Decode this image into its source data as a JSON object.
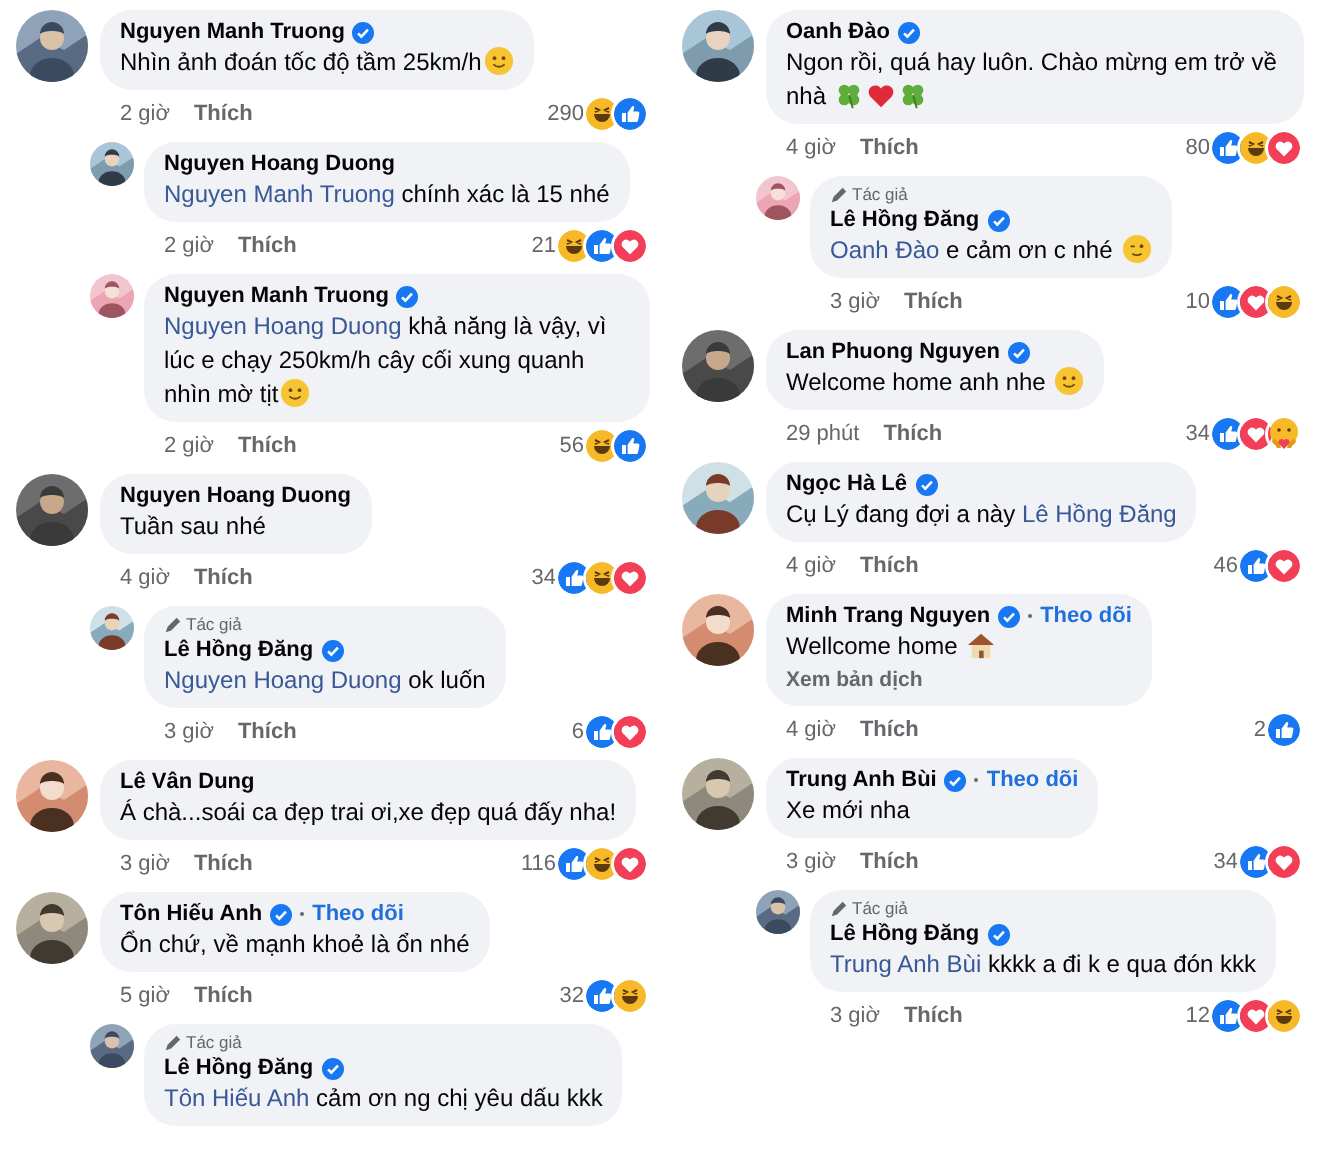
{
  "columns": [
    {
      "comments": [
        {
          "reply": false,
          "author": "Nguyen Manh Truong",
          "verified": true,
          "body": [
            {
              "kind": "plain",
              "text": "Nhìn ảnh đoán tốc độ tầm 25km/h"
            },
            {
              "kind": "smiley"
            }
          ],
          "time": "2 giờ",
          "like_label": "Thích",
          "count": "290",
          "reactions": [
            {
              "kind": "haha"
            },
            {
              "kind": "like"
            }
          ]
        },
        {
          "reply": true,
          "author": "Nguyen Hoang Duong",
          "verified": false,
          "body": [
            {
              "kind": "mention",
              "text": "Nguyen Manh Truong"
            },
            {
              "kind": "plain",
              "text": " chính xác là 15 nhé"
            }
          ],
          "time": "2 giờ",
          "like_label": "Thích",
          "count": "21",
          "reactions": [
            {
              "kind": "haha"
            },
            {
              "kind": "like"
            },
            {
              "kind": "love"
            }
          ]
        },
        {
          "reply": true,
          "author": "Nguyen Manh Truong",
          "verified": true,
          "body": [
            {
              "kind": "mention",
              "text": "Nguyen Hoang Duong"
            },
            {
              "kind": "plain",
              "text": " khả năng là vậy, vì lúc e chạy 250km/h cây cối xung quanh nhìn mờ tịt"
            },
            {
              "kind": "smiley"
            }
          ],
          "time": "2 giờ",
          "like_label": "Thích",
          "count": "56",
          "reactions": [
            {
              "kind": "haha"
            },
            {
              "kind": "like"
            }
          ]
        },
        {
          "reply": false,
          "author": "Nguyen Hoang Duong",
          "verified": false,
          "body": [
            {
              "kind": "plain",
              "text": "Tuần sau nhé"
            }
          ],
          "time": "4 giờ",
          "like_label": "Thích",
          "count": "34",
          "reactions": [
            {
              "kind": "like"
            },
            {
              "kind": "haha"
            },
            {
              "kind": "love"
            }
          ]
        },
        {
          "reply": true,
          "author_tag": "Tác giả",
          "author": "Lê Hồng Đăng",
          "verified": true,
          "body": [
            {
              "kind": "mention",
              "text": "Nguyen Hoang Duong"
            },
            {
              "kind": "plain",
              "text": " ok luốn"
            }
          ],
          "time": "3 giờ",
          "like_label": "Thích",
          "count": "6",
          "reactions": [
            {
              "kind": "like"
            },
            {
              "kind": "love"
            }
          ]
        },
        {
          "reply": false,
          "author": "Lê Vân Dung",
          "verified": false,
          "body": [
            {
              "kind": "plain",
              "text": "Á chà...soái ca đẹp trai ơi,xe đẹp quá đấy nha!"
            }
          ],
          "time": "3 giờ",
          "like_label": "Thích",
          "count": "116",
          "reactions": [
            {
              "kind": "like"
            },
            {
              "kind": "haha"
            },
            {
              "kind": "love"
            }
          ]
        },
        {
          "reply": false,
          "author": "Tôn Hiếu Anh",
          "verified": true,
          "follow": "Theo dõi",
          "body": [
            {
              "kind": "plain",
              "text": "Ổn chứ, về mạnh khoẻ là ổn nhé"
            }
          ],
          "time": "5 giờ",
          "like_label": "Thích",
          "count": "32",
          "reactions": [
            {
              "kind": "like"
            },
            {
              "kind": "haha"
            }
          ]
        },
        {
          "reply": true,
          "author_tag": "Tác giả",
          "author": "Lê Hồng Đăng",
          "verified": true,
          "body": [
            {
              "kind": "mention",
              "text": "Tôn Hiếu Anh"
            },
            {
              "kind": "plain",
              "text": " cảm ơn ng chị yêu dấu kkk"
            }
          ]
        }
      ]
    },
    {
      "comments": [
        {
          "reply": false,
          "author": "Oanh Đào",
          "verified": true,
          "body": [
            {
              "kind": "plain",
              "text": "Ngon rồi, quá hay luôn. Chào mừng em trở về nhà "
            },
            {
              "kind": "clover"
            },
            {
              "kind": "heart"
            },
            {
              "kind": "clover"
            }
          ],
          "time": "4 giờ",
          "like_label": "Thích",
          "count": "80",
          "reactions": [
            {
              "kind": "like"
            },
            {
              "kind": "haha"
            },
            {
              "kind": "love"
            }
          ]
        },
        {
          "reply": true,
          "author_tag": "Tác giả",
          "author": "Lê Hồng Đăng",
          "verified": true,
          "body": [
            {
              "kind": "mention",
              "text": "Oanh Đào"
            },
            {
              "kind": "plain",
              "text": " e cảm ơn c nhé "
            },
            {
              "kind": "wink"
            }
          ],
          "time": "3 giờ",
          "like_label": "Thích",
          "count": "10",
          "reactions": [
            {
              "kind": "like"
            },
            {
              "kind": "love"
            },
            {
              "kind": "haha"
            }
          ]
        },
        {
          "reply": false,
          "author": "Lan Phuong Nguyen",
          "verified": true,
          "body": [
            {
              "kind": "plain",
              "text": "Welcome home anh nhe "
            },
            {
              "kind": "smiley"
            }
          ],
          "time": "29 phút",
          "like_label": "Thích",
          "count": "34",
          "reactions": [
            {
              "kind": "like"
            },
            {
              "kind": "love"
            },
            {
              "kind": "care"
            }
          ]
        },
        {
          "reply": false,
          "author": "Ngọc Hà Lê",
          "verified": true,
          "body": [
            {
              "kind": "plain",
              "text": "Cụ Lý đang đợi a này "
            },
            {
              "kind": "mention",
              "text": "Lê Hồng Đăng"
            }
          ],
          "time": "4 giờ",
          "like_label": "Thích",
          "count": "46",
          "reactions": [
            {
              "kind": "like"
            },
            {
              "kind": "love"
            }
          ]
        },
        {
          "reply": false,
          "author": "Minh Trang Nguyen",
          "verified": true,
          "follow": "Theo dõi",
          "body": [
            {
              "kind": "plain",
              "text": "Wellcome home "
            },
            {
              "kind": "house"
            }
          ],
          "translate": "Xem bản dịch",
          "time": "4 giờ",
          "like_label": "Thích",
          "count": "2",
          "reactions": [
            {
              "kind": "like"
            }
          ]
        },
        {
          "reply": false,
          "author": "Trung Anh Bùi",
          "verified": true,
          "follow": "Theo dõi",
          "body": [
            {
              "kind": "plain",
              "text": "Xe mới nha"
            }
          ],
          "time": "3 giờ",
          "like_label": "Thích",
          "count": "34",
          "reactions": [
            {
              "kind": "like"
            },
            {
              "kind": "love"
            }
          ]
        },
        {
          "reply": true,
          "author_tag": "Tác giả",
          "author": "Lê Hồng Đăng",
          "verified": true,
          "body": [
            {
              "kind": "mention",
              "text": "Trung Anh Bùi"
            },
            {
              "kind": "plain",
              "text": " kkkk a đi k e qua đón kkk"
            }
          ],
          "time": "3 giờ",
          "like_label": "Thích",
          "count": "12",
          "reactions": [
            {
              "kind": "like"
            },
            {
              "kind": "love"
            },
            {
              "kind": "haha"
            }
          ]
        }
      ]
    }
  ]
}
